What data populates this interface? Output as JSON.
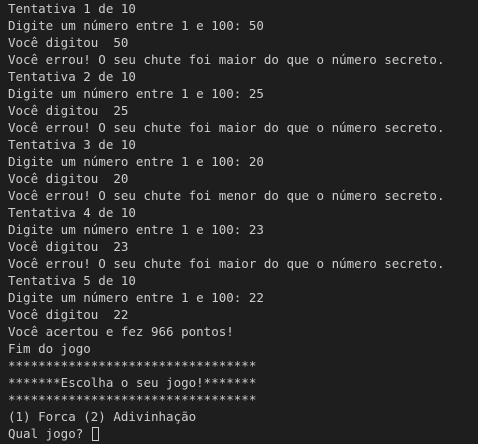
{
  "terminal": {
    "lines": [
      "Tentativa 1 de 10",
      "Digite um número entre 1 e 100: 50",
      "Você digitou  50",
      "Você errou! O seu chute foi maior do que o número secreto.",
      "Tentativa 2 de 10",
      "Digite um número entre 1 e 100: 25",
      "Você digitou  25",
      "Você errou! O seu chute foi maior do que o número secreto.",
      "Tentativa 3 de 10",
      "Digite um número entre 1 e 100: 20",
      "Você digitou  20",
      "Você errou! O seu chute foi menor do que o número secreto.",
      "Tentativa 4 de 10",
      "Digite um número entre 1 e 100: 23",
      "Você digitou  23",
      "Você errou! O seu chute foi maior do que o número secreto.",
      "Tentativa 5 de 10",
      "Digite um número entre 1 e 100: 22",
      "Você digitou  22",
      "Você acertou e fez 966 pontos!",
      "Fim do jogo",
      "*********************************",
      "*******Escolha o seu jogo!*******",
      "*********************************",
      "(1) Forca (2) Adivinhação"
    ],
    "prompt": "Qual jogo? ",
    "colors": {
      "background": "#1e1e1e",
      "text": "#cccccc"
    }
  }
}
